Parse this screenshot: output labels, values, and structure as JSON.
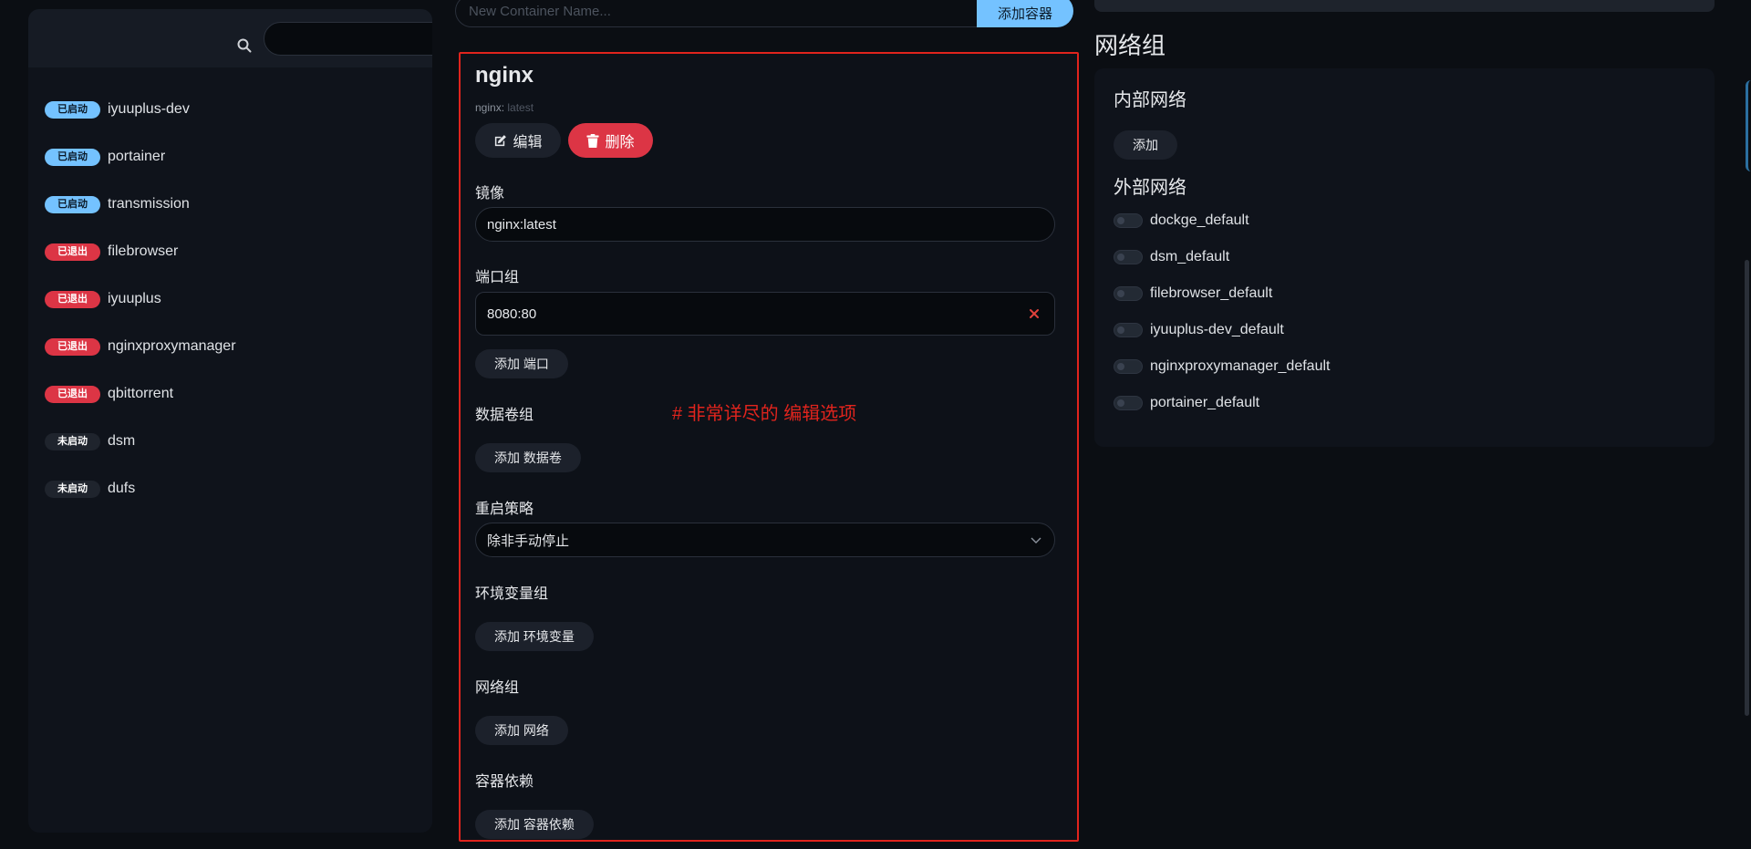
{
  "sidebar": {
    "search": {
      "placeholder": "",
      "value": ""
    },
    "items": [
      {
        "status": "已启动",
        "status_type": "running",
        "name": "iyuuplus-dev"
      },
      {
        "status": "已启动",
        "status_type": "running",
        "name": "portainer"
      },
      {
        "status": "已启动",
        "status_type": "running",
        "name": "transmission"
      },
      {
        "status": "已退出",
        "status_type": "exited",
        "name": "filebrowser"
      },
      {
        "status": "已退出",
        "status_type": "exited",
        "name": "iyuuplus"
      },
      {
        "status": "已退出",
        "status_type": "exited",
        "name": "nginxproxymanager"
      },
      {
        "status": "已退出",
        "status_type": "exited",
        "name": "qbittorrent"
      },
      {
        "status": "未启动",
        "status_type": "stopped",
        "name": "dsm"
      },
      {
        "status": "未启动",
        "status_type": "stopped",
        "name": "dufs"
      }
    ]
  },
  "toolbar": {
    "new_container_placeholder": "New Container Name...",
    "add_container_label": "添加容器"
  },
  "editor": {
    "title": "nginx",
    "image_name": "nginx:",
    "image_tag": " latest",
    "edit_label": "编辑",
    "delete_label": "删除",
    "image_label": "镜像",
    "image_value": "nginx:latest",
    "ports_label": "端口组",
    "ports": [
      "8080:80"
    ],
    "add_port_label": "添加 端口",
    "volumes_label": "数据卷组",
    "add_volume_label": "添加 数据卷",
    "restart_label": "重启策略",
    "restart_value": "除非手动停止",
    "env_label": "环境变量组",
    "add_env_label": "添加 环境变量",
    "network_label": "网络组",
    "add_network_label": "添加 网络",
    "depends_label": "容器依赖",
    "add_depends_label": "添加 容器依赖",
    "annotation": "# 非常详尽的 编辑选项"
  },
  "networks": {
    "heading": "网络组",
    "internal_label": "内部网络",
    "add_label": "添加",
    "external_label": "外部网络",
    "external": [
      "dockge_default",
      "dsm_default",
      "filebrowser_default",
      "iyuuplus-dev_default",
      "nginxproxymanager_default",
      "portainer_default"
    ]
  },
  "colors": {
    "accent": "#74c2ff",
    "danger": "#dc3545",
    "highlight_border": "#e0241d",
    "background": "#0b0e13"
  }
}
